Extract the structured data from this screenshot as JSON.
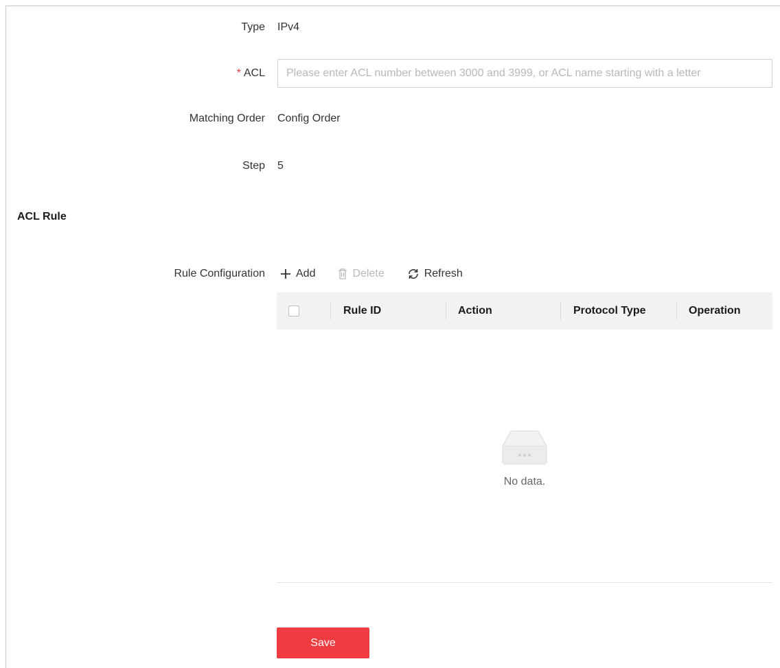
{
  "form": {
    "type_label": "Type",
    "type_value": "IPv4",
    "acl_required_mark": "*",
    "acl_label": "ACL",
    "acl_value": "",
    "acl_placeholder": "Please enter ACL number between 3000 and 3999, or ACL name starting with a letter",
    "matching_order_label": "Matching Order",
    "matching_order_value": "Config Order",
    "step_label": "Step",
    "step_value": "5"
  },
  "acl_rule": {
    "section_title": "ACL Rule",
    "rule_config_label": "Rule Configuration",
    "toolbar": {
      "add_label": "Add",
      "delete_label": "Delete",
      "refresh_label": "Refresh"
    },
    "table": {
      "columns": [
        "Rule ID",
        "Action",
        "Protocol Type",
        "Operation"
      ],
      "rows": [],
      "empty_text": "No data."
    }
  },
  "save_label": "Save",
  "colors": {
    "accent": "#f03c41",
    "required": "#e4393c",
    "header_bg": "#f2f2f2"
  },
  "icons": {
    "add": "plus-icon",
    "delete": "trash-icon",
    "refresh": "refresh-icon",
    "empty": "empty-box-icon"
  }
}
